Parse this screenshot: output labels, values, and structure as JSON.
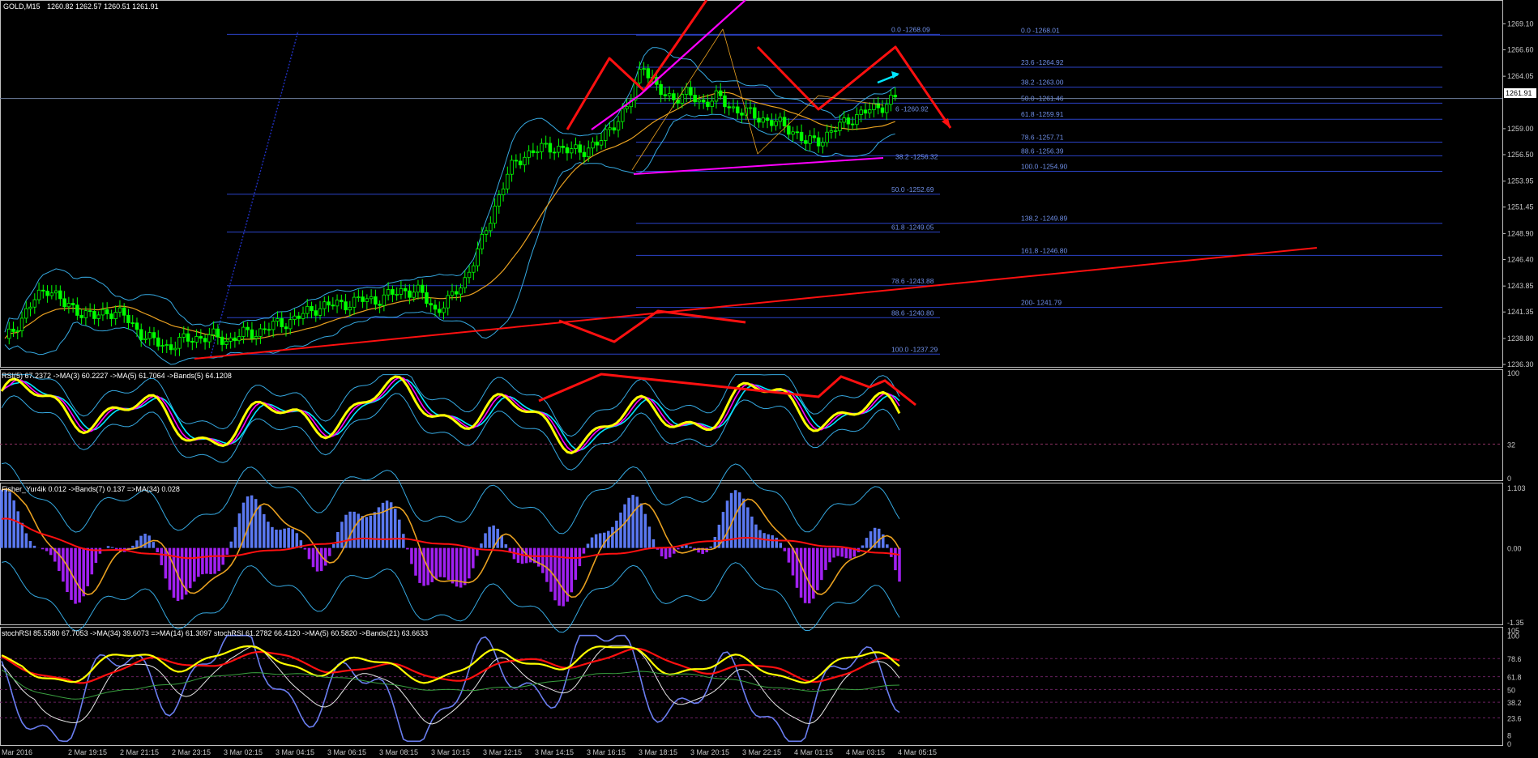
{
  "window": {
    "symbol_header": "GOLD,M15",
    "ohlc": "1260.82 1262.57 1260.51 1261.91",
    "current_price": "1261.91"
  },
  "colors": {
    "background": "#000000",
    "frame": "#c0c0c0",
    "candle_up": "#00ff00",
    "fib_line": "#2b43c8",
    "fib_text": "#6f8fe8",
    "red_arrow": "#ff1010",
    "magenta": "#ff00ff",
    "cyan": "#00e5ff",
    "yellow": "#ffff00",
    "orange": "#e8a020",
    "bands": "#35a8e0",
    "hist_up": "#5a78f0",
    "hist_down": "#a020f0"
  },
  "chart_data": [
    {
      "type": "candlestick",
      "title": "GOLD,M15",
      "ylim": [
        1236.3,
        1270.3
      ],
      "y_ticks": [
        "1269.10",
        "1266.60",
        "1264.05",
        "1261.91",
        "1259.00",
        "1256.50",
        "1253.95",
        "1251.45",
        "1248.90",
        "1246.40",
        "1243.85",
        "1241.35",
        "1238.80",
        "1236.30"
      ],
      "x_ticks": [
        "Mar 2016",
        "2 Mar 19:15",
        "2 Mar 21:15",
        "2 Mar 23:15",
        "3 Mar 02:15",
        "3 Mar 04:15",
        "3 Mar 06:15",
        "3 Mar 08:15",
        "3 Mar 10:15",
        "3 Mar 12:15",
        "3 Mar 14:15",
        "3 Mar 16:15",
        "3 Mar 18:15",
        "3 Mar 20:15",
        "3 Mar 22:15",
        "4 Mar 01:15",
        "4 Mar 03:15",
        "4 Mar 05:15"
      ],
      "close_path": [
        1238.5,
        1240.5,
        1242.5,
        1243.8,
        1242.0,
        1241.5,
        1240.8,
        1241.5,
        1241.0,
        1239.5,
        1238.5,
        1238.0,
        1238.6,
        1238.9,
        1239.0,
        1238.6,
        1239.2,
        1239.4,
        1240.0,
        1240.4,
        1241.0,
        1241.8,
        1242.0,
        1242.2,
        1242.5,
        1242.5,
        1243.0,
        1243.5,
        1243.2,
        1241.5,
        1242.5,
        1244.5,
        1247.5,
        1251.5,
        1255.0,
        1256.5,
        1257.0,
        1257.3,
        1256.8,
        1257.0,
        1257.5,
        1259.5,
        1261.0,
        1265.5,
        1262.5,
        1262.0,
        1262.3,
        1261.5,
        1262.0,
        1261.0,
        1260.5,
        1260.0,
        1259.5,
        1259.0,
        1257.6,
        1258.0,
        1259.0,
        1260.0,
        1260.6,
        1261.2,
        1261.91
      ],
      "fib_levels_left": [
        {
          "label": "0.0 -1268.09",
          "price": 1268.09
        },
        {
          "label": "50.0 -1252.69",
          "price": 1252.69
        },
        {
          "label": "61.8 -1249.05",
          "price": 1249.05
        },
        {
          "label": "78.6 -1243.88",
          "price": 1243.88
        },
        {
          "label": "88.6 -1240.80",
          "price": 1240.8
        },
        {
          "label": "100.0 -1237.29",
          "price": 1237.29
        }
      ],
      "fib_levels_right": [
        {
          "label": "0.0 -1268.01",
          "price": 1268.01
        },
        {
          "label": "23.6 -1264.92",
          "price": 1264.92
        },
        {
          "label": "38.2 -1263.00",
          "price": 1263.0
        },
        {
          "label": "50.0 -1261.46",
          "price": 1261.46
        },
        {
          "label": "61.8 -1259.91",
          "price": 1259.91
        },
        {
          "label": "78.6 -1257.71",
          "price": 1257.71
        },
        {
          "label": "88.6 -1256.39",
          "price": 1256.39
        },
        {
          "label": "100.0 -1254.90",
          "price": 1254.9
        },
        {
          "label": "138.2 -1249.89",
          "price": 1249.89
        },
        {
          "label": "161.8 -1246.80",
          "price": 1246.8
        },
        {
          "label": "200- 1241.79",
          "price": 1241.79
        }
      ],
      "fib_levels_mid": [
        {
          "label": "6 -1260.92",
          "price": 1260.92
        },
        {
          "label": "38.2 -1256.32",
          "price": 1256.32
        }
      ]
    },
    {
      "type": "line",
      "title": "RSI(5) 67.2372 ->MA(3) 60.2227 ->MA(5) 61.7064 ->Bands(5) 64.1208",
      "ylim": [
        0,
        100
      ],
      "y_ticks": [
        "100",
        "32",
        "0"
      ],
      "level": 32
    },
    {
      "type": "bar",
      "title": "Fisher_Yur4ik 0.012 ->Bands(7) 0.137 =>MA(34) 0.028",
      "ylim": [
        -1.35,
        1.103
      ],
      "y_ticks": [
        "1.103",
        "0.00",
        "-1.35"
      ]
    },
    {
      "type": "line",
      "title": "stochRSI 85.5580 67.7053 ->MA(34) 39.6073 =>MA(14) 61.3097 stochRSI 61.2782 66.4120 ->MA(5) 60.5820 ->Bands(21) 63.6633",
      "ylim": [
        0,
        105
      ],
      "y_ticks": [
        "105",
        "100",
        "78.6",
        "61.8",
        "50",
        "38.2",
        "23.6",
        "8",
        "0"
      ]
    }
  ]
}
